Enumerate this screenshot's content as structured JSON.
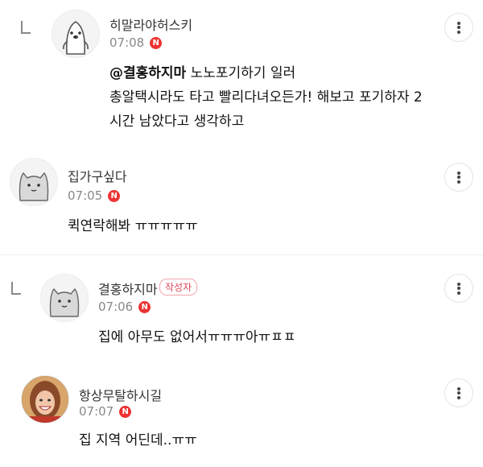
{
  "comments": [
    {
      "nickname": "히말라야허스키",
      "time": "07:08",
      "new_badge": "N",
      "mention": "@결홍하지마",
      "lines": [
        " 노노포기하기 일러",
        "총알택시라도 타고 빨리다녀오든가! 해보고 포기하자 2",
        "시간 남았다고 생각하고"
      ]
    },
    {
      "nickname": "집가구싶다",
      "time": "07:05",
      "new_badge": "N",
      "text": "퀵연락해봐 ㅠㅠㅠㅠㅠ"
    },
    {
      "nickname": "결홍하지마",
      "writer_badge": "작성자",
      "time": "07:06",
      "new_badge": "N",
      "text": "집에 아무도 없어서ㅠㅠㅠ아ㅠㅍㅍ"
    },
    {
      "nickname": "항상무탈하시길",
      "time": "07:07",
      "new_badge": "N",
      "text": "집 지역 어딘데..ㅠㅠ"
    }
  ],
  "icons": {
    "reply": "reply-arrow-icon",
    "more": "more-vertical-icon",
    "avatar_default": "cat-avatar-icon"
  },
  "colors": {
    "new_badge": "#ee3333",
    "writer_badge": "#e0475a",
    "time": "#888888"
  }
}
